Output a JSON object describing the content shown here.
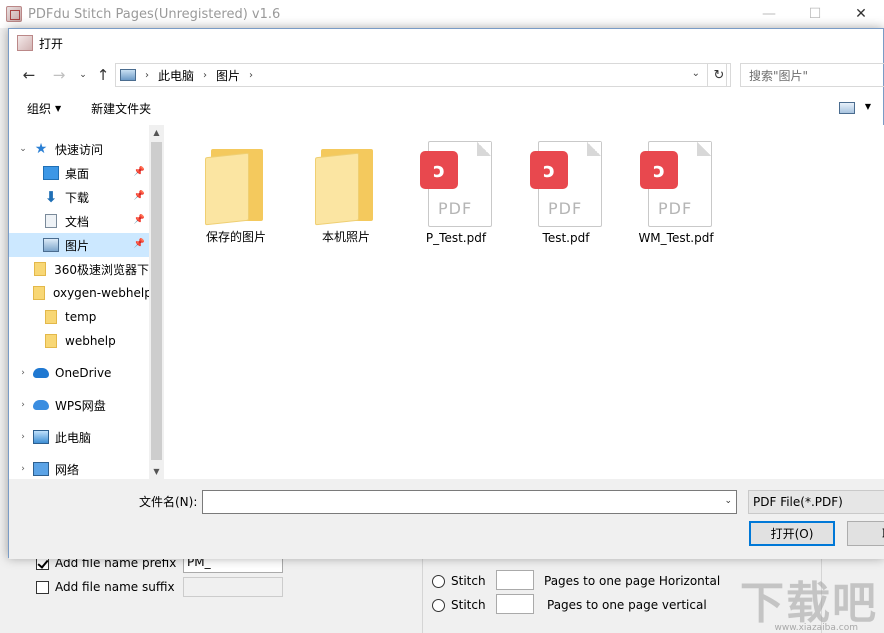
{
  "app": {
    "title": "PDFdu Stitch Pages(Unregistered) v1.6",
    "options": {
      "prefix_label": "Add file name prefix",
      "prefix_value": "PM_",
      "suffix_label": "Add file name suffix",
      "suffix_value": ""
    },
    "stitch": {
      "row1_label": "Stitch",
      "row1_text": "Pages to one page Horizontal",
      "row2_label": "Stitch",
      "row2_text": "Pages to one page vertical"
    }
  },
  "dialog": {
    "title": "打开",
    "breadcrumb": [
      "此电脑",
      "图片"
    ],
    "search_placeholder": "搜索\"图片\"",
    "toolbar": {
      "organize": "组织",
      "new_folder": "新建文件夹"
    },
    "nav": {
      "quick_access": "快速访问",
      "items": [
        {
          "label": "桌面"
        },
        {
          "label": "下载"
        },
        {
          "label": "文档"
        },
        {
          "label": "图片"
        },
        {
          "label": "360极速浏览器下"
        },
        {
          "label": "oxygen-webhelp"
        },
        {
          "label": "temp"
        },
        {
          "label": "webhelp"
        }
      ],
      "onedrive": "OneDrive",
      "wps": "WPS网盘",
      "this_pc": "此电脑",
      "network": "网络"
    },
    "files": [
      {
        "name": "保存的图片",
        "kind": "folder"
      },
      {
        "name": "本机照片",
        "kind": "folder"
      },
      {
        "name": "P_Test.pdf",
        "kind": "pdf"
      },
      {
        "name": "Test.pdf",
        "kind": "pdf"
      },
      {
        "name": "WM_Test.pdf",
        "kind": "pdf"
      }
    ],
    "pdf_glyph": "PDF",
    "filename_label": "文件名(N):",
    "filename_value": "",
    "filetype": "PDF File(*.PDF)",
    "open_button": "打开(O)",
    "cancel_button": "取"
  },
  "watermark": {
    "text": "下载吧",
    "url": "www.xiazaiba.com"
  }
}
